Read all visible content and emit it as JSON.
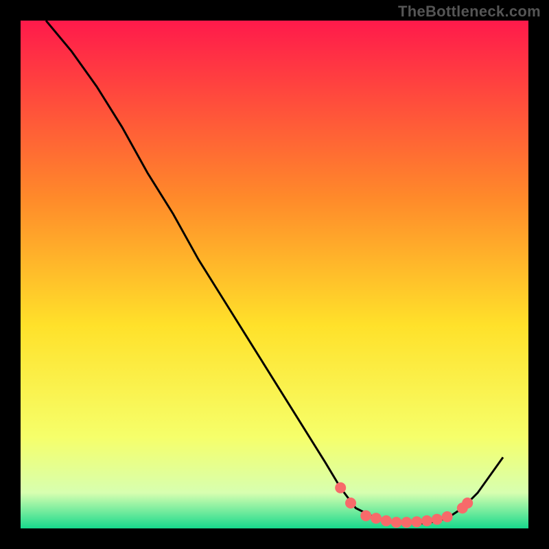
{
  "attribution": "TheBottleneck.com",
  "chart_data": {
    "type": "line",
    "title": "",
    "xlabel": "",
    "ylabel": "",
    "xlim": [
      0,
      100
    ],
    "ylim": [
      0,
      100
    ],
    "gradient_colors": {
      "top": "#ff1a4b",
      "upper_mid": "#ff8a2a",
      "mid": "#ffe12a",
      "lower_mid": "#f6ff6a",
      "near_bottom": "#d7ffb0",
      "bottom": "#17d98c"
    },
    "curve": [
      {
        "x": 5,
        "y": 100
      },
      {
        "x": 10,
        "y": 94
      },
      {
        "x": 15,
        "y": 87
      },
      {
        "x": 20,
        "y": 79
      },
      {
        "x": 25,
        "y": 70
      },
      {
        "x": 30,
        "y": 62
      },
      {
        "x": 35,
        "y": 53
      },
      {
        "x": 40,
        "y": 45
      },
      {
        "x": 45,
        "y": 37
      },
      {
        "x": 50,
        "y": 29
      },
      {
        "x": 55,
        "y": 21
      },
      {
        "x": 60,
        "y": 13
      },
      {
        "x": 63,
        "y": 8
      },
      {
        "x": 66,
        "y": 4
      },
      {
        "x": 70,
        "y": 2
      },
      {
        "x": 75,
        "y": 1
      },
      {
        "x": 80,
        "y": 1
      },
      {
        "x": 84,
        "y": 2
      },
      {
        "x": 87,
        "y": 4
      },
      {
        "x": 90,
        "y": 7
      },
      {
        "x": 95,
        "y": 14
      }
    ],
    "markers": [
      {
        "x": 63,
        "y": 8
      },
      {
        "x": 65,
        "y": 5
      },
      {
        "x": 68,
        "y": 2.5
      },
      {
        "x": 70,
        "y": 2
      },
      {
        "x": 72,
        "y": 1.5
      },
      {
        "x": 74,
        "y": 1.2
      },
      {
        "x": 76,
        "y": 1.2
      },
      {
        "x": 78,
        "y": 1.3
      },
      {
        "x": 80,
        "y": 1.5
      },
      {
        "x": 82,
        "y": 1.8
      },
      {
        "x": 84,
        "y": 2.3
      },
      {
        "x": 87,
        "y": 4
      },
      {
        "x": 88,
        "y": 5
      }
    ],
    "marker_color": "#f76a6a",
    "curve_color": "#000000"
  }
}
